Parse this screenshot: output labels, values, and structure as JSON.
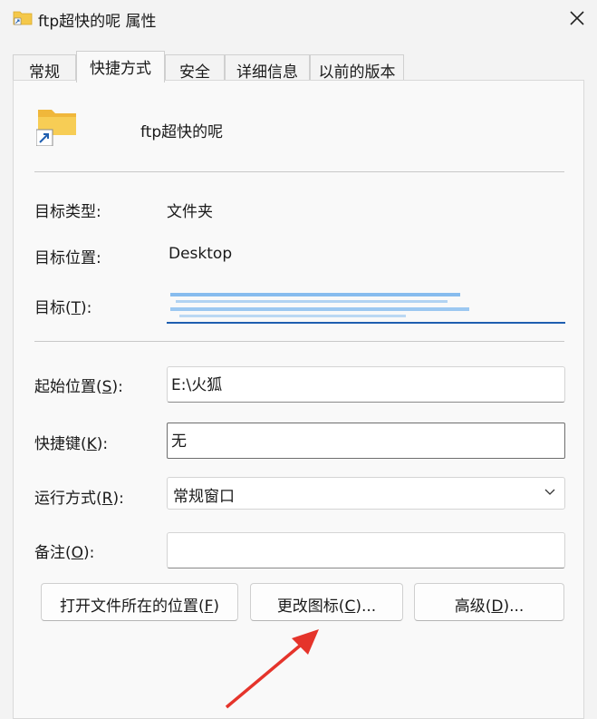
{
  "window": {
    "title": "ftp超快的呢 属性",
    "close_label": "✕"
  },
  "tabs": [
    {
      "label": "常规",
      "active": false
    },
    {
      "label": "快捷方式",
      "active": true
    },
    {
      "label": "安全",
      "active": false
    },
    {
      "label": "详细信息",
      "active": false
    },
    {
      "label": "以前的版本",
      "active": false
    }
  ],
  "shortcut": {
    "name": "ftp超快的呢",
    "icon": "folder-shortcut-icon"
  },
  "fields": {
    "target_type": {
      "label": "目标类型:",
      "value": "文件夹"
    },
    "target_location": {
      "label": "目标位置:",
      "value": "Desktop"
    },
    "target": {
      "label_pre": "目标(",
      "label_key": "T",
      "label_post": "):",
      "value_redacted": true
    },
    "start_in": {
      "label_pre": "起始位置(",
      "label_key": "S",
      "label_post": "):",
      "value": "E:\\火狐"
    },
    "shortcut_key": {
      "label_pre": "快捷键(",
      "label_key": "K",
      "label_post": "):",
      "value": "无"
    },
    "run": {
      "label_pre": "运行方式(",
      "label_key": "R",
      "label_post": "):",
      "value": "常规窗口"
    },
    "comment": {
      "label_pre": "备注(",
      "label_key": "O",
      "label_post": "):",
      "value": ""
    }
  },
  "buttons": {
    "open_location": {
      "pre": "打开文件所在的位置(",
      "key": "F",
      "post": ")"
    },
    "change_icon": {
      "pre": "更改图标(",
      "key": "C",
      "post": ")..."
    },
    "advanced": {
      "pre": "高级(",
      "key": "D",
      "post": ")..."
    }
  },
  "colors": {
    "accent": "#1f5fb0",
    "annotation_arrow": "#e5342b",
    "folder": "#f4c84a"
  }
}
